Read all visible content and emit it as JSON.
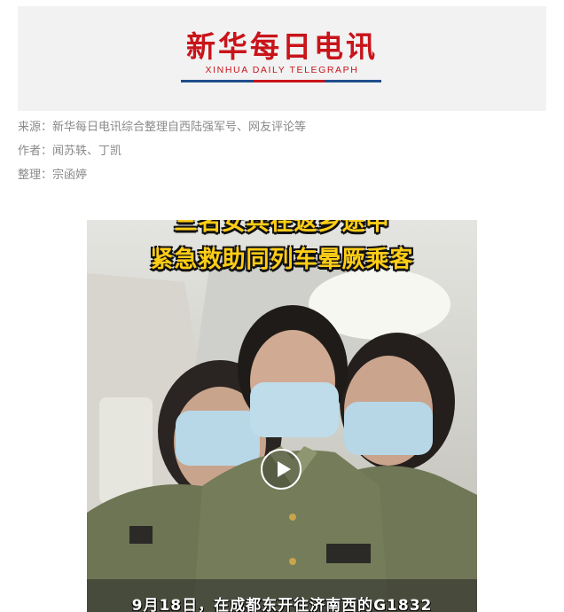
{
  "banner": {
    "title_cn": "新华每日电讯",
    "title_en": "XINHUA DAILY TELEGRAPH"
  },
  "meta": {
    "source": "来源：新华每日电讯综合整理自西陆强军号、网友评论等",
    "author": "作者：闻苏轶、丁凯",
    "editor": "整理：宗函婷"
  },
  "video": {
    "caption_top": "三名女兵在返乡途中",
    "caption_main": "紧急救助同列车晕厥乘客",
    "caption_bottom": "9月18日，在成都东开往济南西的G1832",
    "play_icon": "play-icon"
  }
}
